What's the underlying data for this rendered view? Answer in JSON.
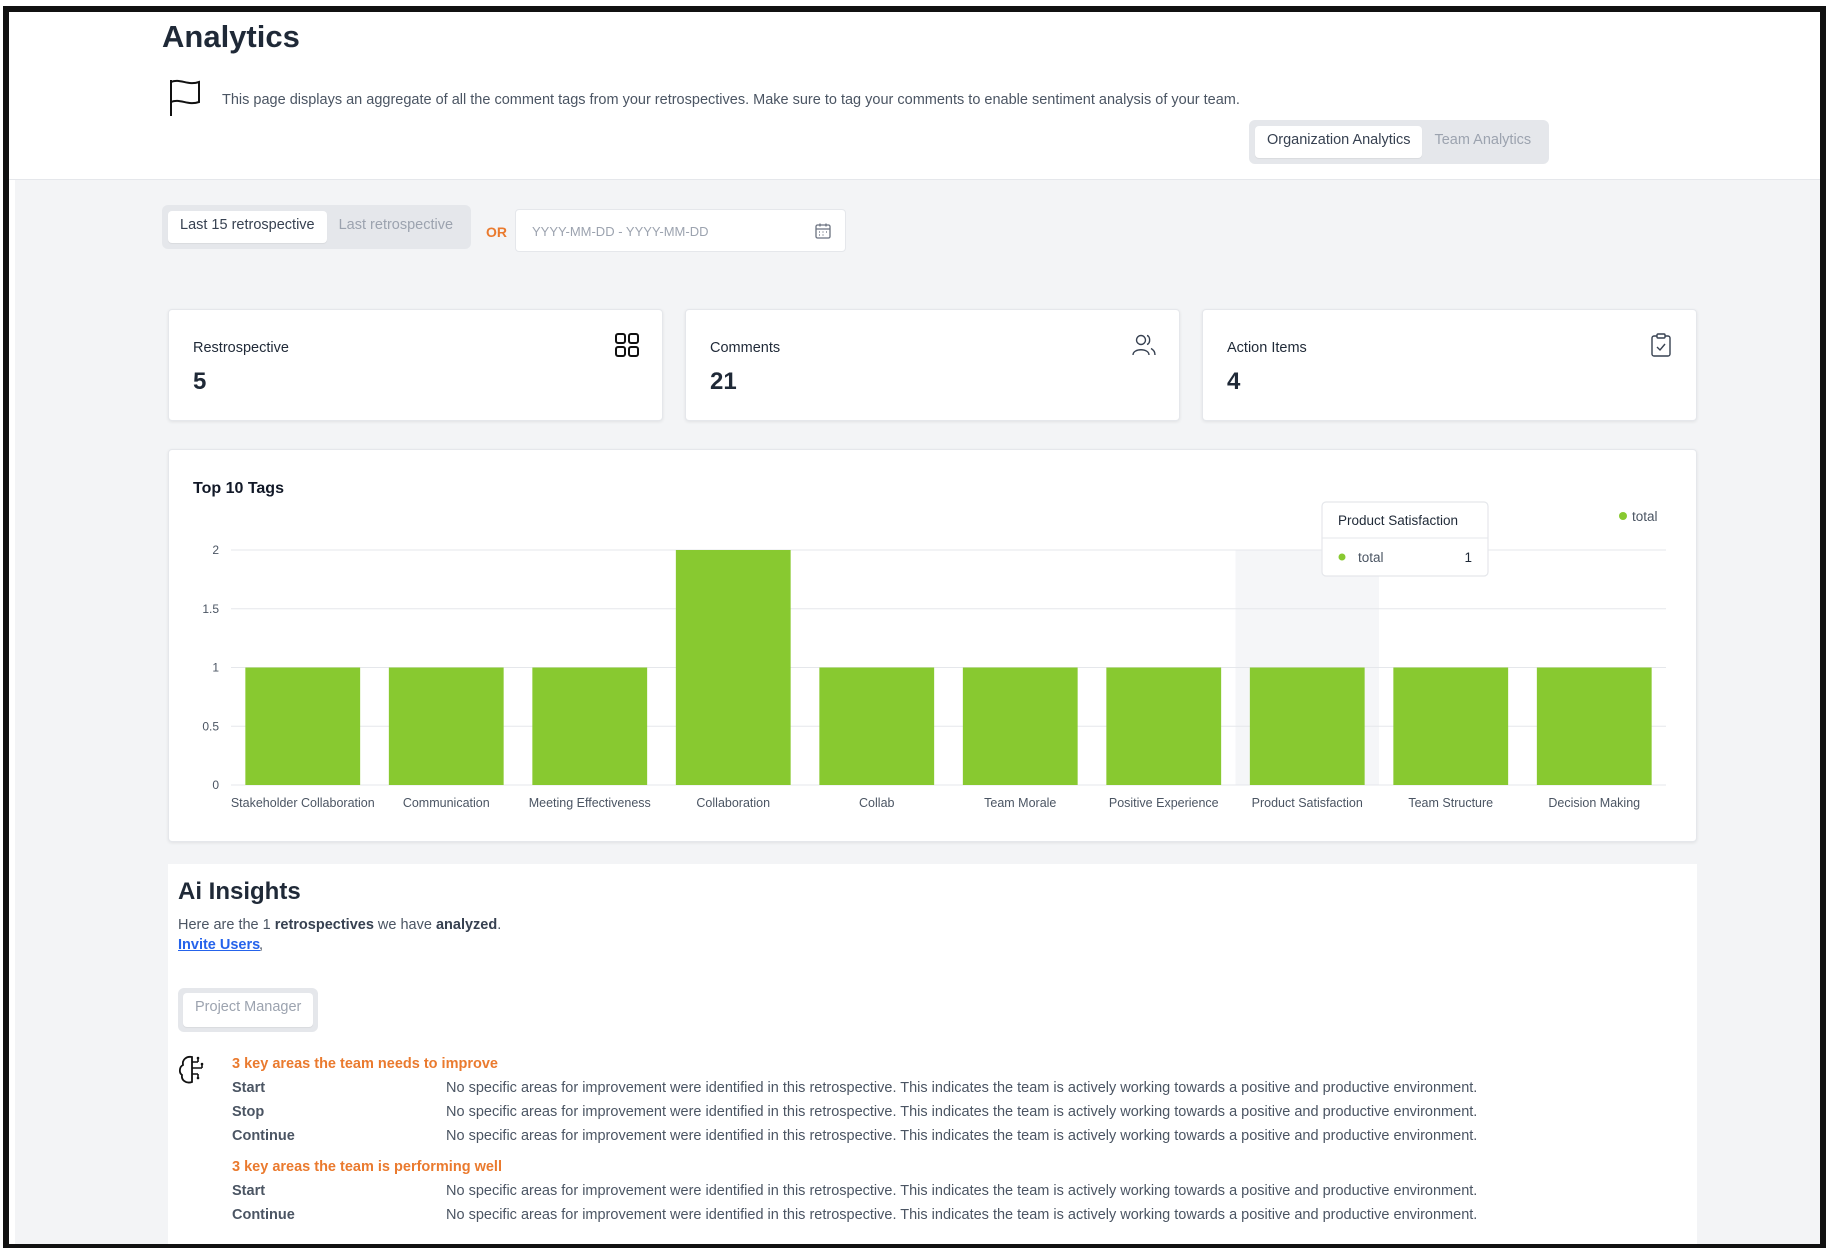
{
  "page": {
    "title": "Analytics",
    "description": "This page displays an aggregate of all the comment tags from your retrospectives. Make sure to tag your comments to enable sentiment analysis of your team."
  },
  "analytics_toggle": {
    "options": [
      "Organization Analytics",
      "Team Analytics"
    ],
    "selected": "Organization Analytics"
  },
  "range_filter": {
    "options": [
      "Last 15 retrospective",
      "Last retrospective"
    ],
    "selected": "Last 15 retrospective",
    "or_label": "OR",
    "date_placeholder": "YYYY-MM-DD - YYYY-MM-DD"
  },
  "stats": [
    {
      "label": "Restrospective",
      "value": "5",
      "icon": "grid-icon"
    },
    {
      "label": "Comments",
      "value": "21",
      "icon": "users-icon"
    },
    {
      "label": "Action Items",
      "value": "4",
      "icon": "clipboard-icon"
    }
  ],
  "chart_data": {
    "type": "bar",
    "title": "Top 10 Tags",
    "categories": [
      "Stakeholder Collaboration",
      "Communication",
      "Meeting Effectiveness",
      "Collaboration",
      "Collab",
      "Team Morale",
      "Positive Experience",
      "Product Satisfaction",
      "Team Structure",
      "Decision Making"
    ],
    "series": [
      {
        "name": "total",
        "values": [
          1,
          1,
          1,
          2,
          1,
          1,
          1,
          1,
          1,
          1
        ]
      }
    ],
    "ylim": [
      0,
      2
    ],
    "yticks": [
      "0",
      "0.5",
      "1",
      "1.5",
      "2"
    ],
    "grid": true,
    "legend": "top-right",
    "color": "#88c930",
    "tooltip": {
      "category": "Product Satisfaction",
      "series": "total",
      "value": "1"
    }
  },
  "insights": {
    "title": "Ai Insights",
    "summary_pre": "Here are the",
    "summary_count": "1",
    "summary_mid1": "retrospectives",
    "summary_mid2": "we have",
    "summary_mid3": "analyzed",
    "summary_end": ".",
    "invite_label": "Invite Users",
    "role_option": "Project Manager",
    "improve_heading": "3 key areas the team needs to improve",
    "improve_rows": [
      {
        "key": "Start",
        "text": "No specific areas for improvement were identified in this retrospective. This indicates the team is actively working towards a positive and productive environment."
      },
      {
        "key": "Stop",
        "text": "No specific areas for improvement were identified in this retrospective. This indicates the team is actively working towards a positive and productive environment."
      },
      {
        "key": "Continue",
        "text": "No specific areas for improvement were identified in this retrospective. This indicates the team is actively working towards a positive and productive environment."
      }
    ],
    "well_heading": "3 key areas the team is performing well",
    "well_rows": [
      {
        "key": "Start",
        "text": "No specific areas for improvement were identified in this retrospective. This indicates the team is actively working towards a positive and productive environment."
      },
      {
        "key": "Continue",
        "text": "No specific areas for improvement were identified in this retrospective. This indicates the team is actively working towards a positive and productive environment."
      }
    ]
  }
}
